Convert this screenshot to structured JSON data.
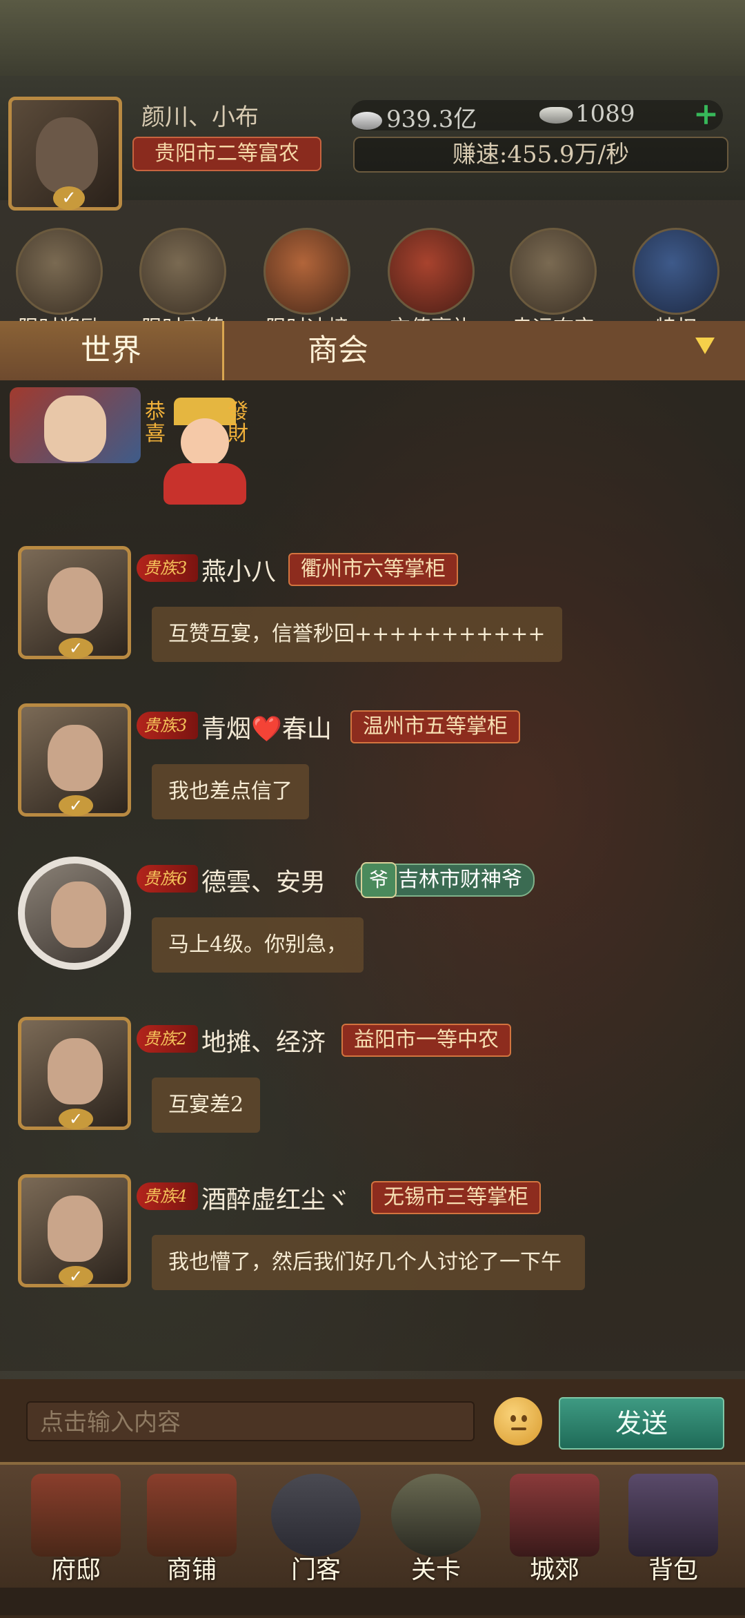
{
  "player": {
    "name": "颜川、小布",
    "title": "贵阳市二等富农",
    "silver": "939.3亿",
    "gold": "1089",
    "speed": "赚速:455.9万/秒"
  },
  "activities": [
    {
      "label": "限时奖励",
      "icon": "treasure-pot-icon"
    },
    {
      "label": "限时充值",
      "icon": "gold-ingot-icon"
    },
    {
      "label": "限时冲榜",
      "icon": "lion-medal-icon"
    },
    {
      "label": "充值豪礼",
      "icon": "gift-bag-icon"
    },
    {
      "label": "幸运夺宝",
      "icon": "treasure-grid-icon"
    },
    {
      "label": "特权",
      "icon": "privilege-card-icon"
    }
  ],
  "tabs": {
    "world": "世界",
    "guild": "商会"
  },
  "gift": {
    "left": "恭喜",
    "right": "發財"
  },
  "messages": [
    {
      "vip": "贵族3",
      "name": "燕小八",
      "rank": "衢州市六等掌柜",
      "text": "互赞互宴，信誉秒回+++++++++++"
    },
    {
      "vip": "贵族3",
      "name": "青烟❤️春山",
      "rank": "温州市五等掌柜",
      "text": "我也差点信了"
    },
    {
      "vip": "贵族6",
      "name": "德雲、安男",
      "rank": "吉林市财神爷",
      "rank_tag": "爷",
      "text": "马上4级。你别急，"
    },
    {
      "vip": "贵族2",
      "name": "地摊、经济",
      "rank": "益阳市一等中农",
      "text": "互宴差2"
    },
    {
      "vip": "贵族4",
      "name": "酒醉虚红尘ヾ",
      "rank": "无锡市三等掌柜",
      "text": "我也懵了，然后我们好几个人讨论了一下午"
    }
  ],
  "input": {
    "placeholder": "点击输入内容",
    "send": "发送"
  },
  "nav": [
    {
      "label": "府邸",
      "icon": "mansion-icon"
    },
    {
      "label": "商铺",
      "icon": "shop-icon"
    },
    {
      "label": "门客",
      "icon": "retainer-icon"
    },
    {
      "label": "关卡",
      "icon": "swords-icon"
    },
    {
      "label": "城郊",
      "icon": "carriage-icon"
    },
    {
      "label": "背包",
      "icon": "backpack-icon"
    }
  ],
  "colors": {
    "accent": "#d9a650",
    "rank_red": "#8d2c1e",
    "send_green": "#2d8a70"
  }
}
